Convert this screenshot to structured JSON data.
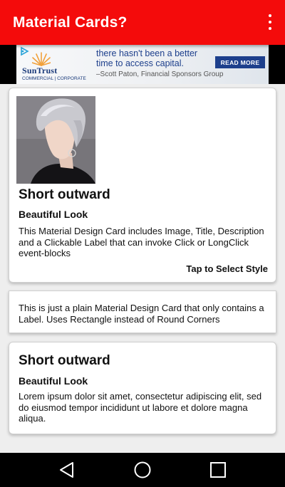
{
  "app_bar": {
    "title": "Material Cards?",
    "color": "#f40b0b",
    "menu_icon": "more-vert-icon"
  },
  "ad": {
    "brand": "SunTrust",
    "brand_sub": "COMMERCIAL | CORPORATE",
    "headline": "there hasn't been a better time to access capital.",
    "quote": "–Scott Paton, Financial Sponsors Group",
    "cta": "READ MORE",
    "brand_color": "#1d3f8c"
  },
  "cards": [
    {
      "image": "short-haircut-photo",
      "title": "Short outward",
      "subtitle": "Beautiful Look",
      "description": "This Material Design Card includes Image, Title, Description and a Clickable Label that can invoke Click or LongClick event-blocks",
      "action": "Tap to Select Style"
    },
    {
      "description": "This is just a plain Material Design Card that only contains a Label. Uses Rectangle instead of Round Corners"
    },
    {
      "title": "Short outward",
      "subtitle": "Beautiful Look",
      "description": "Lorem ipsum dolor sit amet, consectetur adipiscing elit, sed do eiusmod tempor incididunt ut labore et dolore magna aliqua."
    }
  ],
  "nav_bar": {
    "back_icon": "back-triangle-icon",
    "home_icon": "home-circle-icon",
    "recents_icon": "recents-square-icon"
  }
}
